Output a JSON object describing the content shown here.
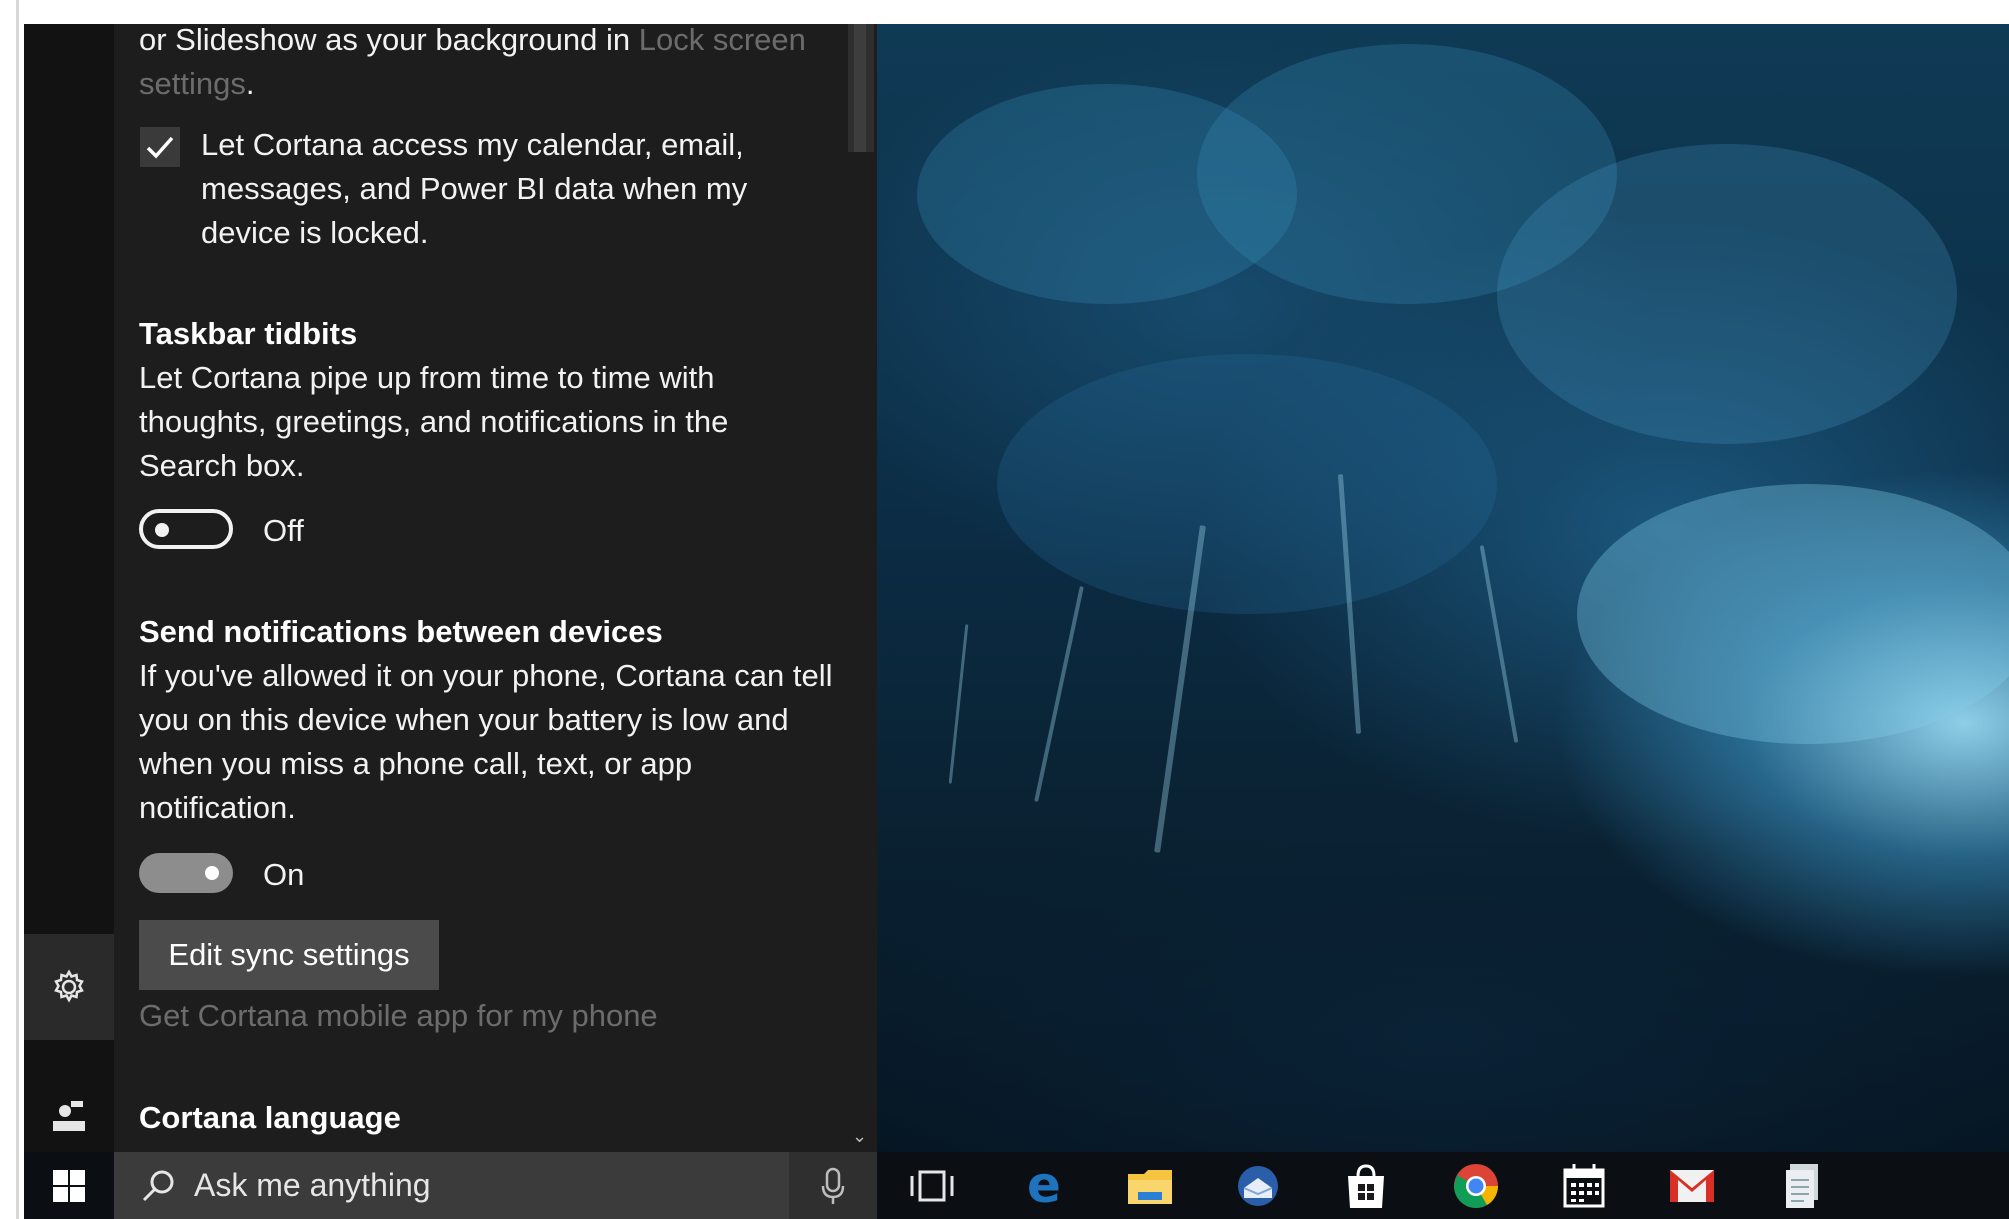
{
  "cortana": {
    "intro_text": "or Slideshow as your background in",
    "intro_link": "Lock screen settings",
    "intro_end": ".",
    "lock_checkbox": {
      "label": "Let Cortana access my calendar, email, messages, and Power BI data when my device is locked.",
      "checked": true
    },
    "taskbar_tidbits": {
      "heading": "Taskbar tidbits",
      "description": "Let Cortana pipe up from time to time with thoughts, greetings, and notifications in the Search box.",
      "state": "Off"
    },
    "send_notifications": {
      "heading": "Send notifications between devices",
      "description": "If you've allowed it on your phone, Cortana can tell you on this device when your battery is low and when you miss a phone call, text, or app notification.",
      "state": "On"
    },
    "edit_sync_button": "Edit sync settings",
    "mobile_app_link": "Get Cortana mobile app for my phone",
    "language_heading": "Cortana language"
  },
  "taskbar": {
    "search_placeholder": "Ask me anything",
    "icons": [
      "task-view-icon",
      "edge-icon",
      "file-explorer-icon",
      "thunderbird-icon",
      "store-icon",
      "chrome-icon",
      "calendar-icon",
      "gmail-icon",
      "documents-icon"
    ]
  },
  "colors": {
    "panel": "#1e1d1d",
    "rail": "#121212",
    "taskbar": "#0b0f14",
    "edge_blue": "#1e73be",
    "faded_text": "#6c6c6c"
  }
}
